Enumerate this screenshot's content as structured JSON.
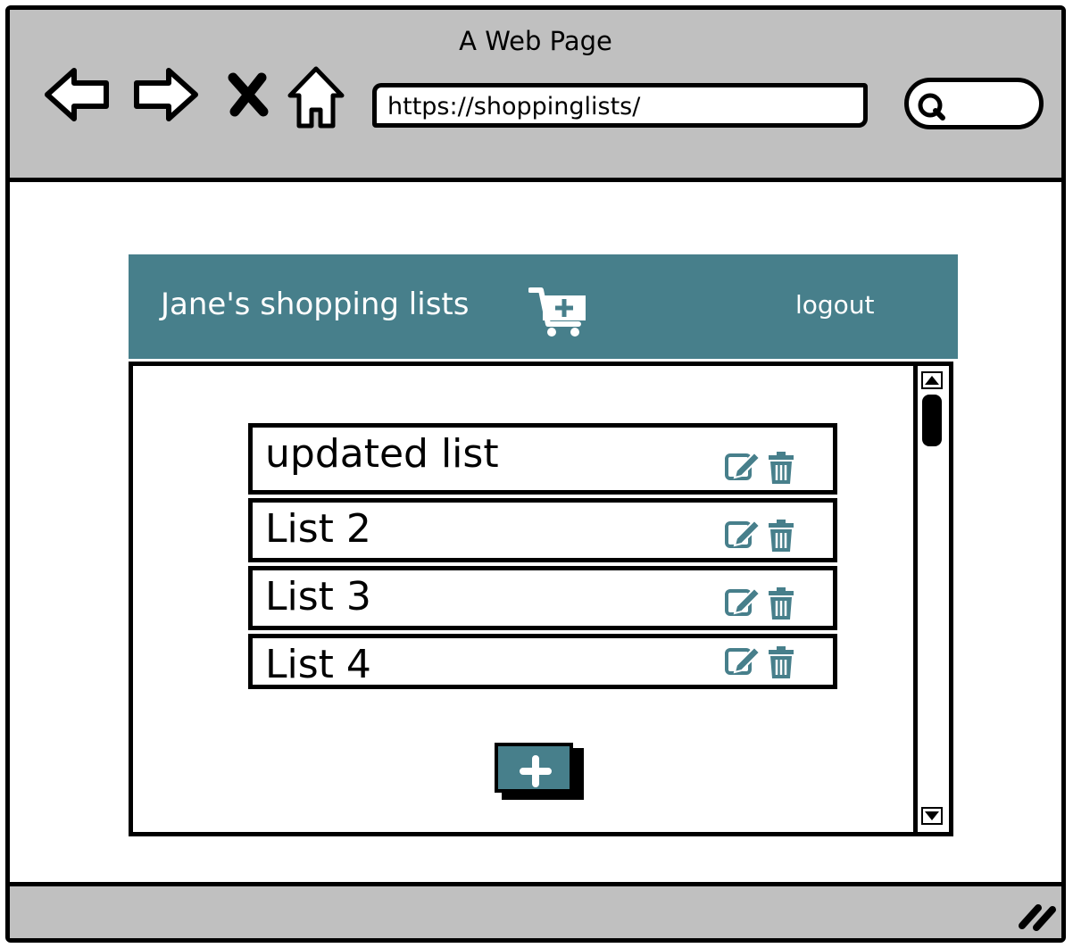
{
  "window": {
    "title": "A Web Page",
    "url": "https://shoppinglists/"
  },
  "nav_icons": [
    "back-arrow-icon",
    "forward-arrow-icon",
    "close-x-icon",
    "home-icon"
  ],
  "app": {
    "title": "Jane's shopping lists",
    "logout_label": "logout",
    "accent_color": "#477f8b"
  },
  "lists": [
    {
      "name": "updated list"
    },
    {
      "name": "List 2"
    },
    {
      "name": "List 3"
    },
    {
      "name": "List 4"
    }
  ],
  "row_actions": [
    "edit-icon",
    "trash-icon"
  ],
  "add_button_icon": "plus-icon"
}
